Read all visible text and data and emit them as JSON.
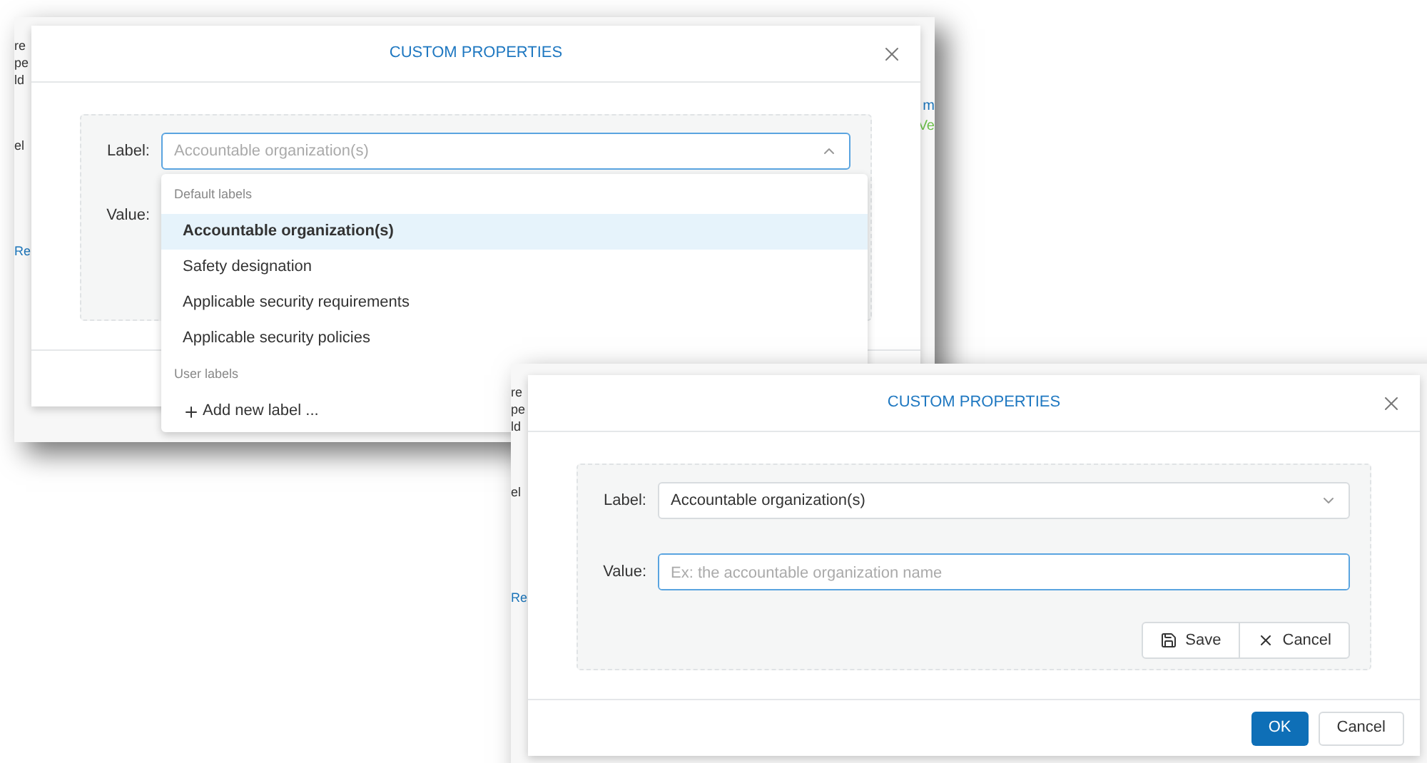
{
  "screenshots": [
    {
      "left_fragments": [
        {
          "text": "re",
          "kind": "plain"
        },
        {
          "text": "pe",
          "kind": "plain"
        },
        {
          "text": "ld",
          "kind": "plain"
        },
        {
          "text": "el",
          "kind": "plain"
        },
        {
          "text": "Re",
          "kind": "link"
        }
      ],
      "right_fragments": [
        {
          "text": "m",
          "kind": "link"
        },
        {
          "text": "Ve",
          "kind": "status"
        }
      ],
      "dialog": {
        "title": "CUSTOM PROPERTIES",
        "label_field": {
          "label": "Label:",
          "placeholder": "Accountable organization(s)",
          "expanded": true,
          "focused": true
        },
        "value_field": {
          "label": "Value:"
        },
        "dropdown": {
          "groups": [
            {
              "heading": "Default labels",
              "items": [
                {
                  "text": "Accountable organization(s)",
                  "selected": true,
                  "kind": "option"
                },
                {
                  "text": "Safety designation",
                  "selected": false,
                  "kind": "option"
                },
                {
                  "text": "Applicable security requirements",
                  "selected": false,
                  "kind": "option"
                },
                {
                  "text": "Applicable security policies",
                  "selected": false,
                  "kind": "option"
                }
              ]
            },
            {
              "heading": "User labels",
              "items": [
                {
                  "text": "Add new label ...",
                  "selected": false,
                  "kind": "add"
                }
              ]
            }
          ]
        }
      }
    },
    {
      "left_fragments": [
        {
          "text": "re",
          "kind": "plain"
        },
        {
          "text": "pe",
          "kind": "plain"
        },
        {
          "text": "ld",
          "kind": "plain"
        },
        {
          "text": "el",
          "kind": "plain"
        },
        {
          "text": "Re",
          "kind": "link"
        }
      ],
      "dialog": {
        "title": "CUSTOM PROPERTIES",
        "label_field": {
          "label": "Label:",
          "value": "Accountable organization(s)",
          "expanded": false,
          "focused": false
        },
        "value_field": {
          "label": "Value:",
          "placeholder": "Ex: the accountable organization name",
          "focused": true
        },
        "form_buttons": [
          {
            "text": "Save",
            "kind": "save"
          },
          {
            "text": "Cancel",
            "kind": "cancel"
          }
        ],
        "footer_buttons": [
          {
            "text": "OK",
            "kind": "primary"
          },
          {
            "text": "Cancel",
            "kind": "secondary"
          }
        ]
      }
    }
  ]
}
